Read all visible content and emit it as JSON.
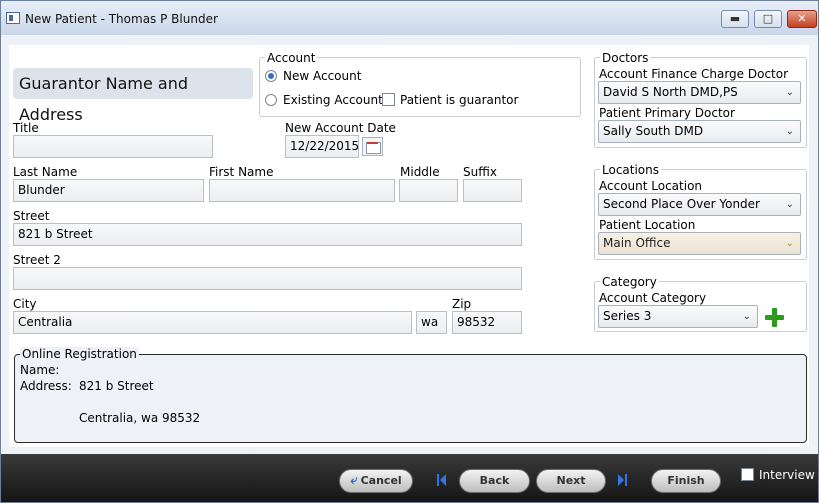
{
  "window": {
    "title": "New Patient - Thomas P Blunder"
  },
  "guarantor": {
    "header": "Guarantor Name and Address",
    "title_label": "Title",
    "title_value": "",
    "last_name_label": "Last Name",
    "last_name_value": "Blunder",
    "first_name_label": "First Name",
    "first_name_value": "",
    "middle_label": "Middle",
    "middle_value": "",
    "suffix_label": "Suffix",
    "suffix_value": "",
    "street_label": "Street",
    "street_value": "821 b Street",
    "street2_label": "Street 2",
    "street2_value": "",
    "city_label": "City",
    "city_value": "Centralia",
    "state_value": "wa",
    "zip_label": "Zip",
    "zip_value": "98532"
  },
  "account": {
    "legend": "Account",
    "new_account": "New Account",
    "existing_account": "Existing Account",
    "patient_is_guarantor": "Patient is guarantor",
    "selected": "new",
    "date_label": "New Account Date",
    "date_value": "12/22/2015"
  },
  "doctors": {
    "legend": "Doctors",
    "finance_label": "Account Finance Charge Doctor",
    "finance_value": "David S North DMD,PS",
    "primary_label": "Patient Primary Doctor",
    "primary_value": "Sally South DMD"
  },
  "locations": {
    "legend": "Locations",
    "account_label": "Account Location",
    "account_value": "Second Place Over Yonder",
    "patient_label": "Patient Location",
    "patient_value": "Main Office"
  },
  "category": {
    "legend": "Category",
    "account_label": "Account Category",
    "account_value": "Series 3"
  },
  "online": {
    "legend": "Online Registration",
    "name_label": "Name:",
    "name_value": "",
    "address_label": "Address:",
    "address_line1": "821 b Street",
    "address_line2": "Centralia, wa 98532"
  },
  "footer": {
    "cancel": "Cancel",
    "back": "Back",
    "next": "Next",
    "finish": "Finish",
    "interview": "Interview"
  },
  "colors": {
    "nav_icon": "#2f78e3",
    "add_icon": "#2a9b1a",
    "close_button": "#c3401f"
  }
}
